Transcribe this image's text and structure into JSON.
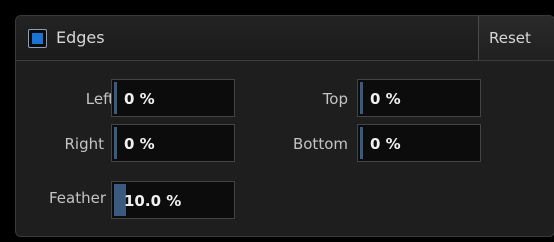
{
  "panel": {
    "title": "Edges",
    "enabled": true,
    "reset_label": "Reset",
    "accent_color": "#1a74d6"
  },
  "fields": {
    "left": {
      "label": "Left",
      "value": "0 %"
    },
    "top": {
      "label": "Top",
      "value": "0 %"
    },
    "right": {
      "label": "Right",
      "value": "0 %"
    },
    "bottom": {
      "label": "Bottom",
      "value": "0 %"
    },
    "feather": {
      "label": "Feather",
      "value": "10.0 %"
    }
  }
}
